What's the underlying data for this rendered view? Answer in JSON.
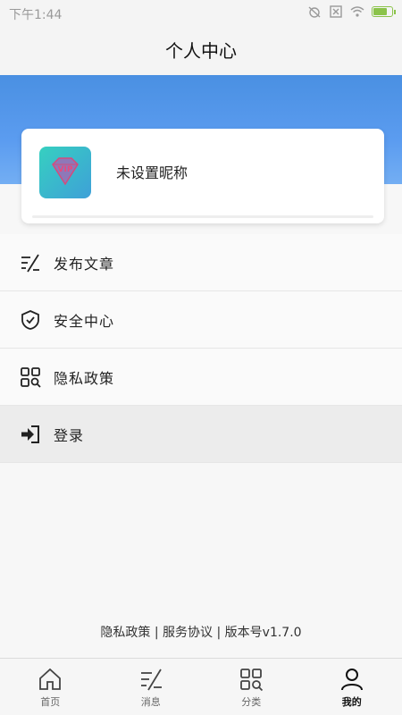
{
  "status_bar": {
    "time": "下午1:44"
  },
  "header": {
    "title": "个人中心"
  },
  "profile": {
    "nickname": "未设置昵称",
    "avatar_badge": "VIP"
  },
  "menu": [
    {
      "label": "发布文章",
      "icon": "publish-icon"
    },
    {
      "label": "安全中心",
      "icon": "shield-check-icon"
    },
    {
      "label": "隐私政策",
      "icon": "grid-search-icon"
    },
    {
      "label": "登录",
      "icon": "login-icon"
    }
  ],
  "footer": {
    "links": "隐私政策 | 服务协议 | 版本号v1.7.0"
  },
  "bottom_nav": [
    {
      "label": "首页",
      "icon": "home-icon"
    },
    {
      "label": "消息",
      "icon": "message-icon"
    },
    {
      "label": "分类",
      "icon": "category-icon"
    },
    {
      "label": "我的",
      "icon": "user-icon"
    }
  ],
  "colors": {
    "header_blue": "#4a90e2",
    "avatar": "#36d0c0",
    "battery": "#8bc34a"
  }
}
